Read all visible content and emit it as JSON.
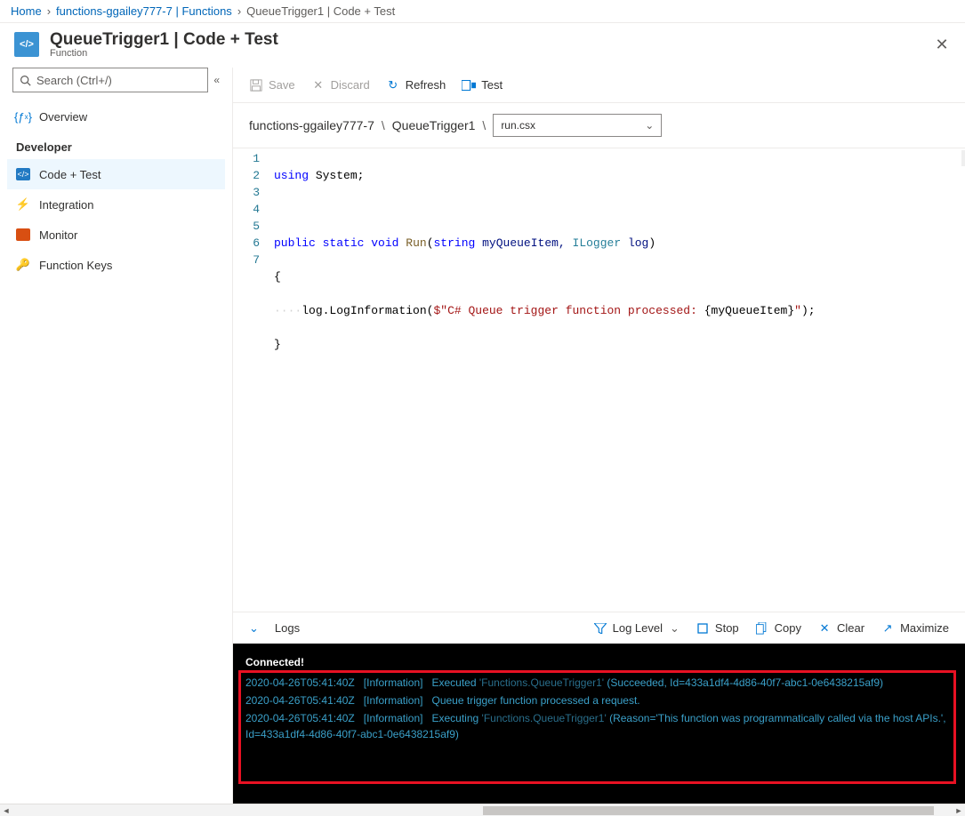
{
  "breadcrumb": {
    "home": "Home",
    "parent": "functions-ggailey777-7 | Functions",
    "current": "QueueTrigger1 | Code + Test"
  },
  "header": {
    "title": "QueueTrigger1 | Code + Test",
    "subtitle": "Function"
  },
  "search": {
    "placeholder": "Search (Ctrl+/)"
  },
  "sidebar": {
    "overview": "Overview",
    "section": "Developer",
    "items": [
      {
        "label": "Code + Test"
      },
      {
        "label": "Integration"
      },
      {
        "label": "Monitor"
      },
      {
        "label": "Function Keys"
      }
    ]
  },
  "toolbar": {
    "save": "Save",
    "discard": "Discard",
    "refresh": "Refresh",
    "test": "Test"
  },
  "pathbar": {
    "seg1": "functions-ggailey777-7",
    "seg2": "QueueTrigger1",
    "file": "run.csx"
  },
  "code": {
    "line_numbers": [
      "1",
      "2",
      "3",
      "4",
      "5",
      "6",
      "7"
    ],
    "l1_using": "using",
    "l1_system": " System;",
    "l3_public": "public",
    "l3_static": "static",
    "l3_void": "void",
    "l3_run": "Run",
    "l3_sig_open": "(",
    "l3_string1": "string",
    "l3_param1": " myQueueItem, ",
    "l3_ilogger": "ILogger",
    "l3_param2": " log",
    "l3_sig_close": ")",
    "l4_brace": "{",
    "l5_indent": "····",
    "l5_call": "log.LogInformation(",
    "l5_dollar": "$",
    "l5_str1": "\"C# Queue trigger function processed: ",
    "l5_interp": "{myQueueItem}",
    "l5_str2": "\"",
    "l5_close": ");",
    "l6_brace": "}"
  },
  "logs_header": {
    "logs": "Logs",
    "log_level": "Log Level",
    "stop": "Stop",
    "copy": "Copy",
    "clear": "Clear",
    "maximize": "Maximize"
  },
  "logs": {
    "connected": "Connected!",
    "entries": [
      {
        "ts": "2020-04-26T05:41:40Z",
        "level": "[Information]",
        "prefix": "Executed ",
        "fn": "'Functions.QueueTrigger1'",
        "suffix": " (Succeeded, Id=433a1df4-4d86-40f7-abc1-0e6438215af9)"
      },
      {
        "ts": "2020-04-26T05:41:40Z",
        "level": "[Information]",
        "prefix": "Queue trigger function processed a request.",
        "fn": "",
        "suffix": ""
      },
      {
        "ts": "2020-04-26T05:41:40Z",
        "level": "[Information]",
        "prefix": "Executing ",
        "fn": "'Functions.QueueTrigger1'",
        "suffix": " (Reason='This function was programmatically called via the host APIs.', Id=433a1df4-4d86-40f7-abc1-0e6438215af9)"
      }
    ]
  }
}
